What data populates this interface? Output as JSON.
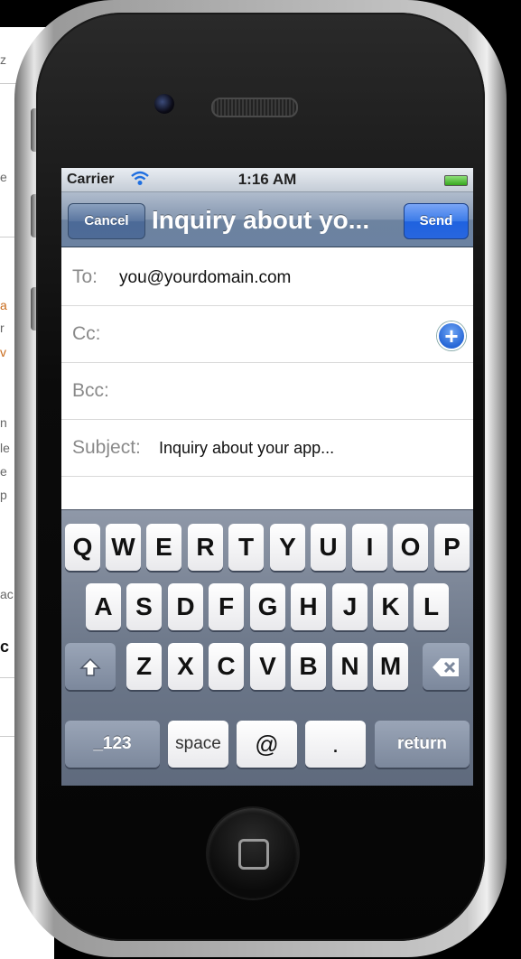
{
  "statusbar": {
    "carrier": "Carrier",
    "time": "1:16 AM"
  },
  "navbar": {
    "cancel_label": "Cancel",
    "title": "Inquiry about yo...",
    "send_label": "Send"
  },
  "fields": {
    "to_label": "To:",
    "to_value": "you@yourdomain.com",
    "cc_label": "Cc:",
    "bcc_label": "Bcc:",
    "subject_label": "Subject:",
    "subject_value": "Inquiry about your app..."
  },
  "keyboard": {
    "row1": [
      "Q",
      "W",
      "E",
      "R",
      "T",
      "Y",
      "U",
      "I",
      "O",
      "P"
    ],
    "row2": [
      "A",
      "S",
      "D",
      "F",
      "G",
      "H",
      "J",
      "K",
      "L"
    ],
    "row3": [
      "Z",
      "X",
      "C",
      "V",
      "B",
      "N",
      "M"
    ],
    "numbers_label": "_123",
    "space_label": "space",
    "at_label": "@",
    "dot_label": ".",
    "return_label": "return"
  },
  "background": {
    "fragments": [
      "z",
      "e",
      "a",
      "r",
      "v",
      "n",
      "le",
      "e",
      "p",
      "ac",
      "c"
    ]
  },
  "colors": {
    "send": "#2866df",
    "navbar": "#6b82a1",
    "add": "#2767d6"
  }
}
